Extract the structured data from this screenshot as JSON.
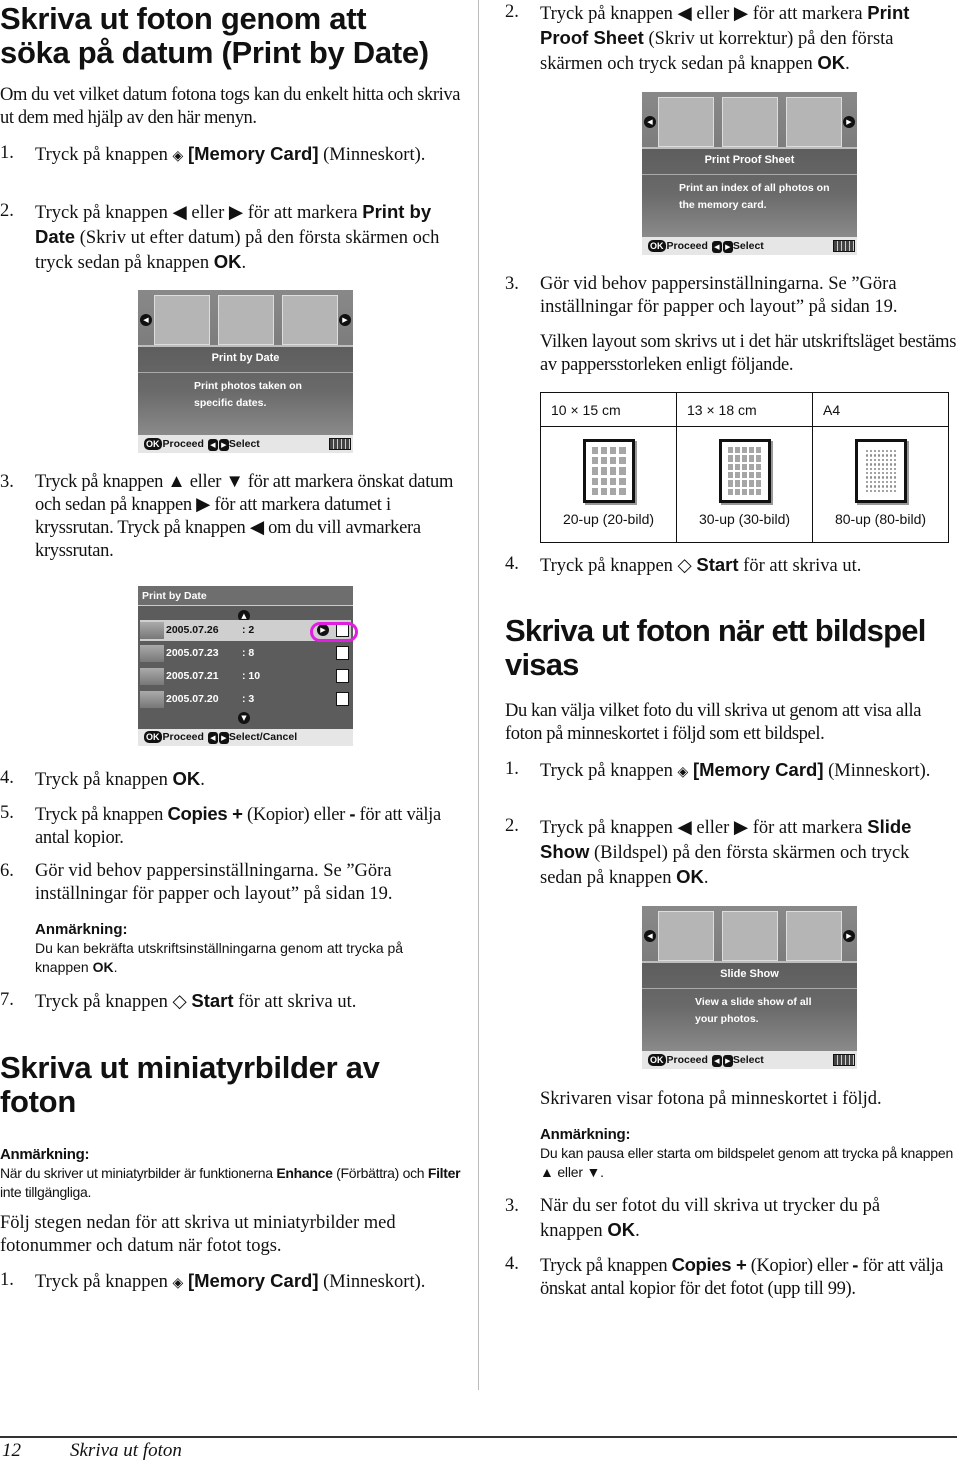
{
  "page": {
    "number": "12",
    "footer_title": "Skriva ut foton"
  },
  "left": {
    "section1": {
      "title_line1": "Skriva ut foton genom att",
      "title_line2": "söka på datum (Print by Date)",
      "intro": "Om du vet vilket datum fotona togs kan du enkelt hitta och skriva ut dem med hjälp av den här menyn.",
      "steps": [
        {
          "num": "1.",
          "pre": "Tryck på knappen ",
          "icon": "memory-card",
          "bold": "[Memory Card]",
          "post": " (Minneskort)."
        },
        {
          "num": "2.",
          "pre": "Tryck på knappen ◀ eller ▶ för att markera ",
          "bold": "Print by Date",
          "post": " (Skriv ut efter datum) på den första skärmen och tryck sedan på knappen ",
          "bold2": "OK",
          "post2": "."
        },
        {
          "num": "3.",
          "text": "Tryck på knappen ▲ eller ▼ för att markera önskat datum och sedan på knappen ▶ för att markera datumet i kryssrutan. Tryck på knappen ◀ om du vill avmarkera kryssrutan."
        },
        {
          "num": "4.",
          "pre": "Tryck på knappen ",
          "bold": "OK",
          "post": "."
        },
        {
          "num": "5.",
          "pre": "Tryck på knappen ",
          "bold": "Copies +",
          "post": " (Kopior) eller ",
          "bold2": "-",
          "post2": " för att välja antal kopior."
        },
        {
          "num": "6.",
          "text": "Gör vid behov pappersinställningarna. Se ”Göra inställningar för papper och layout” på sidan 19."
        },
        {
          "num": "7.",
          "pre": "Tryck på knappen ◇ ",
          "bold": "Start",
          "post": " för att skriva ut."
        }
      ],
      "note": {
        "title": "Anmärkning:",
        "pre": "Du kan bekräfta utskriftsinställningarna genom att trycka på knappen ",
        "bold": "OK",
        "post": "."
      },
      "screen1": {
        "title": "Print by Date",
        "desc_line1": "Print photos taken on",
        "desc_line2": "specific dates.",
        "ok": "OK",
        "proceed": "Proceed",
        "select": "Select"
      },
      "screen2": {
        "title": "Print by Date",
        "rows": [
          {
            "date": "2005.07.26",
            "count": ": 2",
            "selected": true
          },
          {
            "date": "2005.07.23",
            "count": ": 8",
            "selected": false
          },
          {
            "date": "2005.07.21",
            "count": ": 10",
            "selected": false
          },
          {
            "date": "2005.07.20",
            "count": ": 3",
            "selected": false
          }
        ],
        "ok": "OK",
        "proceed": "Proceed",
        "select": "Select/Cancel",
        "highlight_color": "#e020e0"
      }
    },
    "section2": {
      "title_line1": "Skriva ut miniatyrbilder av",
      "title_line2": "foton",
      "note": {
        "title": "Anmärkning:",
        "pre": "När du skriver ut miniatyrbilder är funktionerna ",
        "bold": "Enhance",
        "mid": " (Förbättra) och ",
        "bold2": "Filter",
        "post": " inte tillgängliga."
      },
      "intro": "Följ stegen nedan för att skriva ut miniatyrbilder med fotonummer och datum när fotot togs.",
      "step1": {
        "num": "1.",
        "pre": "Tryck på knappen ",
        "bold": "[Memory Card]",
        "post": " (Minneskort)."
      }
    }
  },
  "right": {
    "proof": {
      "step2": {
        "num": "2.",
        "pre": "Tryck på knappen ◀ eller ▶ för att markera ",
        "bold": "Print Proof Sheet",
        "post": " (Skriv ut korrektur) på den första skärmen och tryck sedan på knappen ",
        "bold2": "OK",
        "post2": "."
      },
      "screen": {
        "title": "Print Proof Sheet",
        "desc_line1": "Print an index of all photos on",
        "desc_line2": "the memory card.",
        "ok": "OK",
        "proceed": "Proceed",
        "select": "Select"
      },
      "step3": {
        "num": "3.",
        "text": "Gör vid behov pappersinställningarna. Se ”Göra inställningar för papper och layout” på sidan 19."
      },
      "layout_text": "Vilken layout som skrivs ut i det här utskriftsläget bestäms av pappersstorleken enligt följande.",
      "table": {
        "headers": [
          "10 × 15 cm",
          "13 × 18 cm",
          "A4"
        ],
        "layouts": [
          "20-up (20-bild)",
          "30-up (30-bild)",
          "80-up (80-bild)"
        ]
      },
      "step4": {
        "num": "4.",
        "pre": "Tryck på knappen ◇ ",
        "bold": "Start",
        "post": " för att skriva ut."
      }
    },
    "slideshow": {
      "title_line1": "Skriva ut foton när ett bildspel",
      "title_line2": "visas",
      "intro": "Du kan välja vilket foto du vill skriva ut genom att visa alla foton på minneskortet i följd som ett bildspel.",
      "step1": {
        "num": "1.",
        "pre": "Tryck på knappen ",
        "bold": "[Memory Card]",
        "post": " (Minneskort)."
      },
      "step2": {
        "num": "2.",
        "pre": "Tryck på knappen ◀ eller ▶ för att markera ",
        "bold": "Slide Show",
        "post": " (Bildspel) på den första skärmen och tryck sedan på knappen ",
        "bold2": "OK",
        "post2": "."
      },
      "screen": {
        "title": "Slide Show",
        "desc_line1": "View a slide show of all",
        "desc_line2": "your photos.",
        "ok": "OK",
        "proceed": "Proceed",
        "select": "Select"
      },
      "after_screen": "Skrivaren visar fotona på minneskortet i följd.",
      "note": {
        "title": "Anmärkning:",
        "text": "Du kan pausa eller starta om bildspelet genom att trycka på knappen ▲ eller ▼."
      },
      "step3": {
        "num": "3.",
        "pre": "När du ser fotot du vill skriva ut trycker du på knappen ",
        "bold": "OK",
        "post": "."
      },
      "step4": {
        "num": "4.",
        "pre": "Tryck på knappen ",
        "bold": "Copies +",
        "post": " (Kopior) eller ",
        "bold2": "-",
        "post2": " för att välja önskat antal kopior för det fotot (upp till 99)."
      }
    }
  }
}
